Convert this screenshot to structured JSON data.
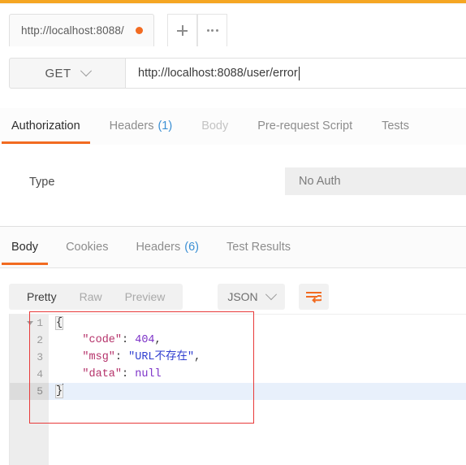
{
  "theme": {
    "accent_orange": "#f26b21",
    "top_strip": "#f5a623",
    "link_blue": "#3a8fd4",
    "annotation_red": "#e83a3a"
  },
  "tabstrip": {
    "request_tab_label": "http://localhost:8088/",
    "unsaved_indicator": "unsaved-dot",
    "new_tab_icon": "plus-icon",
    "more_icon": "ellipsis-icon"
  },
  "urlbar": {
    "method": "GET",
    "method_chevron": "chevron-down-icon",
    "url": "http://localhost:8088/user/error"
  },
  "request_tabs": [
    {
      "label": "Authorization",
      "state": "active",
      "count": ""
    },
    {
      "label": "Headers",
      "state": "normal",
      "count": "(1)"
    },
    {
      "label": "Body",
      "state": "dim",
      "count": ""
    },
    {
      "label": "Pre-request Script",
      "state": "normal",
      "count": ""
    },
    {
      "label": "Tests",
      "state": "normal",
      "count": ""
    }
  ],
  "auth": {
    "type_label": "Type",
    "type_value": "No Auth"
  },
  "response_tabs": [
    {
      "label": "Body",
      "state": "active",
      "count": ""
    },
    {
      "label": "Cookies",
      "state": "normal",
      "count": ""
    },
    {
      "label": "Headers",
      "state": "normal",
      "count": "(6)"
    },
    {
      "label": "Test Results",
      "state": "normal",
      "count": ""
    }
  ],
  "response_toolbar": {
    "view_modes": [
      {
        "label": "Pretty",
        "state": "active"
      },
      {
        "label": "Raw",
        "state": "normal"
      },
      {
        "label": "Preview",
        "state": "normal"
      }
    ],
    "format": "JSON",
    "format_chevron": "chevron-down-icon",
    "wrap_icon": "word-wrap-icon"
  },
  "editor": {
    "line_numbers": [
      "1",
      "2",
      "3",
      "4",
      "5"
    ],
    "active_line": 5,
    "fold_line": 1,
    "lines": [
      {
        "n": "1",
        "tokens": [
          {
            "t": "{",
            "c": "punc brace"
          }
        ]
      },
      {
        "n": "2",
        "tokens": [
          {
            "t": "    ",
            "c": "punc"
          },
          {
            "t": "\"code\"",
            "c": "key"
          },
          {
            "t": ": ",
            "c": "punc"
          },
          {
            "t": "404",
            "c": "num"
          },
          {
            "t": ",",
            "c": "punc"
          }
        ]
      },
      {
        "n": "3",
        "tokens": [
          {
            "t": "    ",
            "c": "punc"
          },
          {
            "t": "\"msg\"",
            "c": "key"
          },
          {
            "t": ": ",
            "c": "punc"
          },
          {
            "t": "\"URL不存在\"",
            "c": "str"
          },
          {
            "t": ",",
            "c": "punc"
          }
        ]
      },
      {
        "n": "4",
        "tokens": [
          {
            "t": "    ",
            "c": "punc"
          },
          {
            "t": "\"data\"",
            "c": "key"
          },
          {
            "t": ": ",
            "c": "punc"
          },
          {
            "t": "null",
            "c": "null"
          }
        ]
      },
      {
        "n": "5",
        "tokens": [
          {
            "t": "}",
            "c": "punc brace"
          }
        ]
      }
    ],
    "json_value": {
      "code": 404,
      "msg": "URL不存在",
      "data": null
    }
  },
  "annotation": {
    "shape": "rectangle",
    "color": "#e83a3a"
  }
}
